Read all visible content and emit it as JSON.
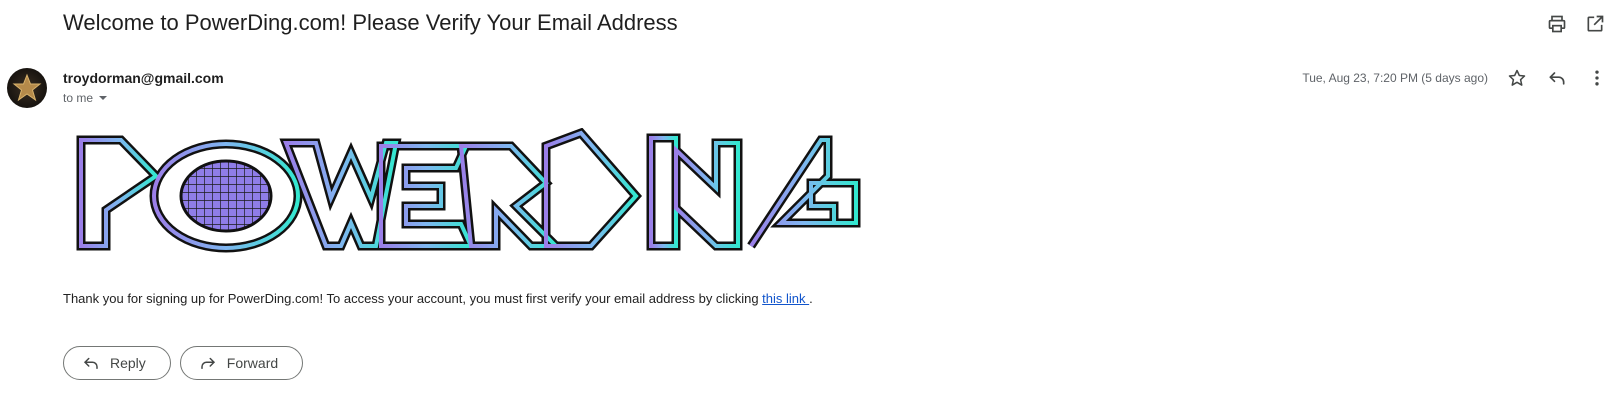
{
  "email": {
    "subject": "Welcome to PowerDing.com! Please Verify Your Email Address",
    "sender": "troydorman@gmail.com",
    "recipient_label": "to me",
    "date": "Tue, Aug 23, 7:20 PM (5 days ago)",
    "logo_text": "POWERDING",
    "body_before_link": "Thank you for signing up for PowerDing.com! To access your account, you must first verify your email address by clicking ",
    "link_text": "this link ",
    "body_after_link": "."
  },
  "actions": {
    "reply_label": "Reply",
    "forward_label": "Forward"
  },
  "icons": {
    "print": "print-icon",
    "open_new_window": "open-in-new-window-icon",
    "star": "star-icon",
    "reply": "reply-icon",
    "more": "more-vertical-icon",
    "dropdown": "caret-down-icon",
    "forward": "forward-icon"
  },
  "colors": {
    "link": "#1155cc",
    "logo_gradient_start": "#9b7ee8",
    "logo_gradient_mid": "#7fb6f0",
    "logo_gradient_end": "#33e8d0"
  }
}
